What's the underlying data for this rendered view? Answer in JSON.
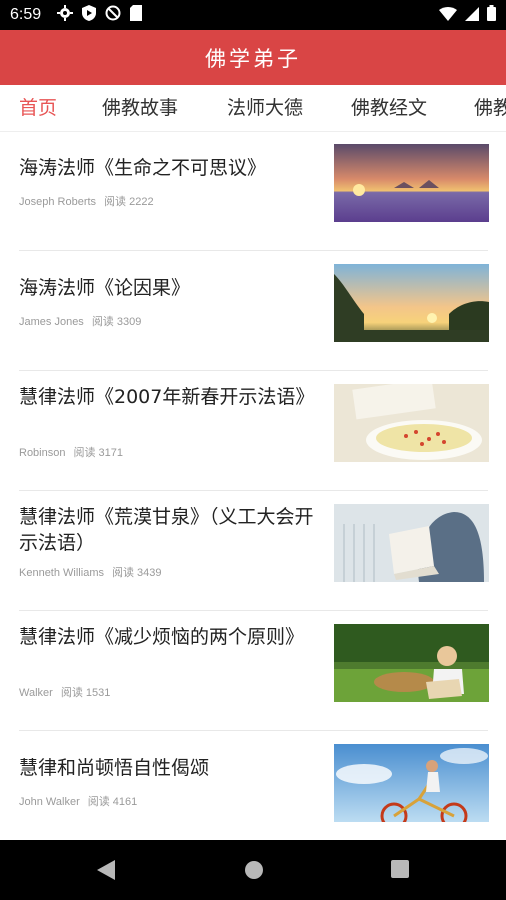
{
  "status_bar": {
    "time": "6:59",
    "left_icons": [
      "gear-icon",
      "shield-play-icon",
      "no-sync-icon",
      "sd-card-icon"
    ],
    "right_icons": [
      "wifi-icon",
      "signal-icon",
      "battery-icon"
    ]
  },
  "app_bar": {
    "title": "佛学弟子"
  },
  "tabs": [
    {
      "label": "首页",
      "active": true
    },
    {
      "label": "佛教故事",
      "active": false
    },
    {
      "label": "法师大德",
      "active": false
    },
    {
      "label": "佛教经文",
      "active": false
    },
    {
      "label": "佛教",
      "active": false
    }
  ],
  "articles": [
    {
      "title": "海涛法师《生命之不可思议》",
      "author": "Joseph Roberts",
      "reads": "阅读 2222",
      "thumb": "sunset-lavender-field-image"
    },
    {
      "title": "海涛法师《论因果》",
      "author": "James Jones",
      "reads": "阅读 3309",
      "thumb": "sunset-trees-image"
    },
    {
      "title": "慧律法师《2007年新春开示法语》",
      "author": "Robinson",
      "reads": "阅读 3171",
      "thumb": "soup-bowl-image"
    },
    {
      "title": "慧律法师《荒漠甘泉》（义工大会开示法语）",
      "author": "Kenneth Williams",
      "reads": "阅读 3439",
      "thumb": "person-reading-book-image"
    },
    {
      "title": "慧律法师《减少烦恼的两个原则》",
      "author": "Walker",
      "reads": "阅读 1531",
      "thumb": "child-reading-grass-image"
    },
    {
      "title": "慧律和尚顿悟自性偈颂",
      "author": "John Walker",
      "reads": "阅读 4161",
      "thumb": "woman-bicycle-sky-image"
    }
  ],
  "nav_bar": {
    "icons": [
      "back-icon",
      "home-icon",
      "recents-icon"
    ]
  },
  "colors": {
    "primary": "#d94545",
    "active_tab": "#e85555",
    "meta": "#9a9a9a"
  }
}
